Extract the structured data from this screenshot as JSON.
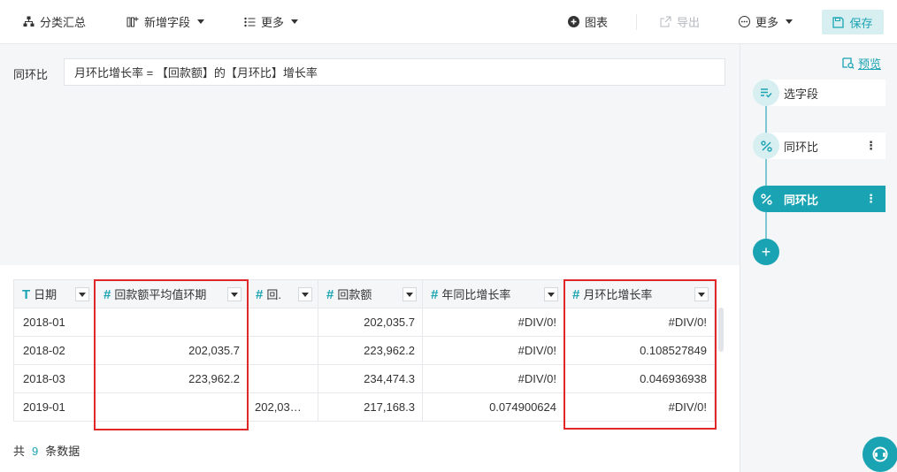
{
  "toolbar": {
    "group_summary": "分类汇总",
    "add_field": "新增字段",
    "more_left": "更多",
    "chart": "图表",
    "export": "导出",
    "more_right": "更多",
    "save": "保存"
  },
  "formula": {
    "label": "同环比",
    "expression": "月环比增长率 = 【回款额】的【月环比】增长率"
  },
  "right_panel": {
    "preview": "预览",
    "steps": [
      {
        "label": "选字段",
        "icon": "select-field-icon"
      },
      {
        "label": "同环比",
        "icon": "percent-icon"
      },
      {
        "label": "同环比",
        "icon": "percent-icon",
        "active": true
      }
    ],
    "add": "+"
  },
  "table": {
    "columns": [
      {
        "type_icon": "T",
        "name": "日期"
      },
      {
        "type_icon": "#",
        "name": "回款额平均值环期"
      },
      {
        "type_icon": "#",
        "name": "回."
      },
      {
        "type_icon": "#",
        "name": "回款额"
      },
      {
        "type_icon": "#",
        "name": "年同比增长率"
      },
      {
        "type_icon": "#",
        "name": "月环比增长率"
      }
    ],
    "rows": [
      [
        "2018-01",
        "",
        "",
        "202,035.7",
        "#DIV/0!",
        "#DIV/0!"
      ],
      [
        "2018-02",
        "202,035.7",
        "",
        "223,962.2",
        "#DIV/0!",
        "0.108527849"
      ],
      [
        "2018-03",
        "223,962.2",
        "",
        "234,474.3",
        "#DIV/0!",
        "0.046936938"
      ],
      [
        "2019-01",
        "",
        "202,03…",
        "217,168.3",
        "0.074900624",
        "#DIV/0!"
      ]
    ]
  },
  "footer": {
    "prefix": "共",
    "count": "9",
    "suffix": "条数据"
  },
  "colors": {
    "accent": "#1aa3b2",
    "highlight": "#e0272a"
  }
}
